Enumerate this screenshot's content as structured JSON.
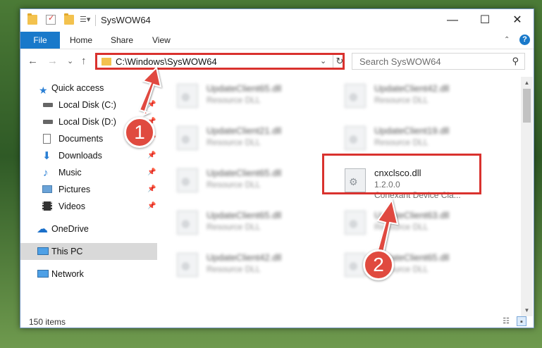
{
  "window": {
    "title": "SysWOW64",
    "minimize": "—",
    "maximize": "☐",
    "close": "✕"
  },
  "ribbon": {
    "file": "File",
    "home": "Home",
    "share": "Share",
    "view": "View",
    "collapse": "⌃",
    "help": "?"
  },
  "nav": {
    "back": "←",
    "forward": "→",
    "recent": "⌄",
    "up": "↑",
    "address": "C:\\Windows\\SysWOW64",
    "address_dropdown": "⌄",
    "refresh": "↻",
    "search_placeholder": "Search SysWOW64",
    "search_icon": "⚲"
  },
  "sidebar": {
    "quick_access": "Quick access",
    "items": [
      {
        "label": "Local Disk (C:)",
        "icon": "drive-icon",
        "pinned": true
      },
      {
        "label": "Local Disk (D:)",
        "icon": "drive-icon",
        "pinned": true
      },
      {
        "label": "Documents",
        "icon": "documents-icon",
        "pinned": true
      },
      {
        "label": "Downloads",
        "icon": "downloads-icon",
        "pinned": true
      },
      {
        "label": "Music",
        "icon": "music-icon",
        "pinned": true
      },
      {
        "label": "Pictures",
        "icon": "pictures-icon",
        "pinned": true
      },
      {
        "label": "Videos",
        "icon": "videos-icon",
        "pinned": true
      }
    ],
    "onedrive": "OneDrive",
    "this_pc": "This PC",
    "network": "Network",
    "pin_glyph": "📌"
  },
  "files": [
    {
      "name": "UpdateClient65.dll",
      "sub1": "Resource DLL"
    },
    {
      "name": "UpdateClient42.dll",
      "sub1": "Resource DLL"
    },
    {
      "name": "UpdateClient21.dll",
      "sub1": "Resource DLL"
    },
    {
      "name": "UpdateClient19.dll",
      "sub1": "Resource DLL"
    },
    {
      "name": "UpdateClient65.dll",
      "sub1": "Resource DLL"
    },
    {
      "name": "cnxclsco.dll",
      "sub1": "1.2.0.0",
      "sub2": "Conexant Device Cla..."
    },
    {
      "name": "UpdateClient65.dll",
      "sub1": "Resource DLL"
    },
    {
      "name": "UpdateClient63.dll",
      "sub1": "Resource DLL"
    },
    {
      "name": "UpdateClient42.dll",
      "sub1": "Resource DLL"
    },
    {
      "name": "UpdateClient65.dll",
      "sub1": "Resource DLL"
    }
  ],
  "status": {
    "count": "150 items"
  },
  "annotations": {
    "step1": "1",
    "step2": "2",
    "color": "#d9322e"
  }
}
